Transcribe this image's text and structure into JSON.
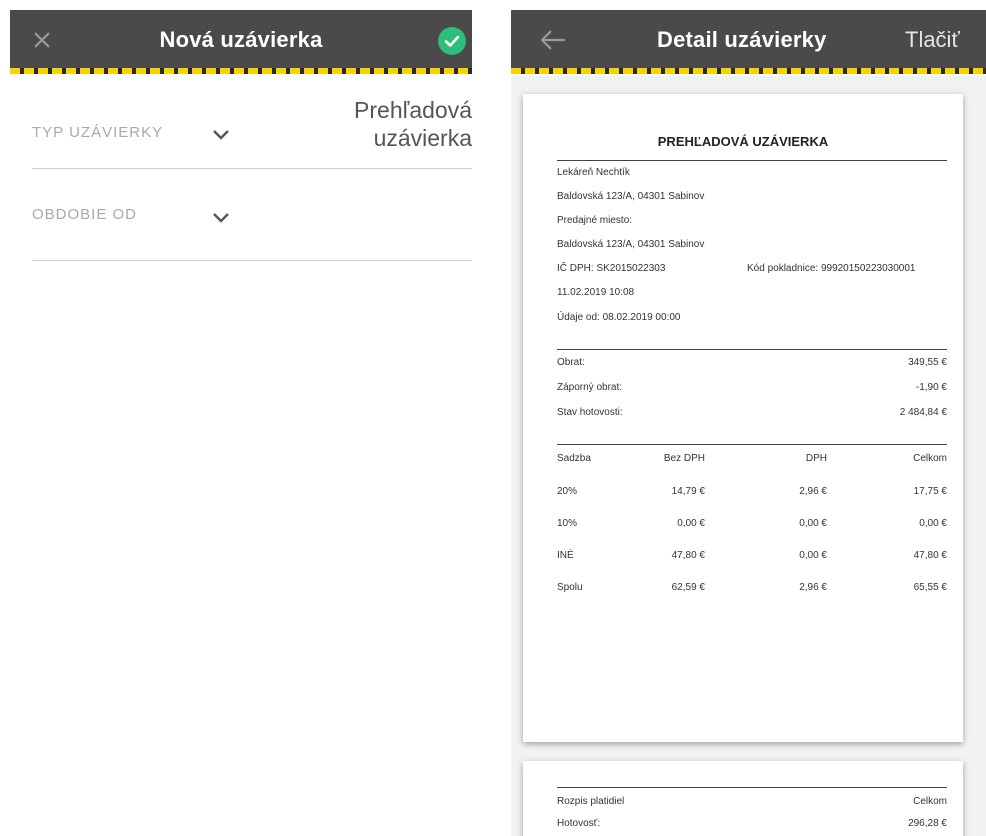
{
  "left_screen": {
    "title": "Nová uzávierka",
    "fields": [
      {
        "label": "TYP UZÁVIERKY",
        "value": "Prehľadová uzávierka"
      },
      {
        "label": "OBDOBIE OD",
        "value": ""
      }
    ]
  },
  "right_screen": {
    "title": "Detail uzávierky",
    "print_label": "Tlačiť",
    "receipt": {
      "title": "PREHĽADOVÁ UZÁVIERKA",
      "header_lines": [
        "Lekáreň Nechtík",
        "Baldovská 123/A, 04301 Sabinov",
        "Predajné miesto:",
        "Baldovská 123/A, 04301 Sabinov",
        "IČ DPH: SK2015022303",
        "11.02.2019 10:08",
        "Údaje od: 08.02.2019 00:00"
      ],
      "register_code": "Kód pokladnice: 99920150223030001",
      "summary": [
        {
          "label": "Obrat:",
          "value": "349,55 €"
        },
        {
          "label": "Záporný obrat:",
          "value": "-1,90 €"
        },
        {
          "label": "Stav hotovosti:",
          "value": "2 484,84 €"
        }
      ],
      "table": {
        "headers": [
          "Sadzba",
          "Bez DPH",
          "DPH",
          "Celkom"
        ],
        "rows": [
          [
            "20%",
            "14,79 €",
            "2,96 €",
            "17,75 €"
          ],
          [
            "10%",
            "0,00 €",
            "0,00 €",
            "0,00 €"
          ],
          [
            "INÉ",
            "47,80 €",
            "0,00 €",
            "47,80 €"
          ],
          [
            "Spolu",
            "62,59 €",
            "2,96 €",
            "65,55 €"
          ]
        ]
      },
      "payments": {
        "header_label": "Rozpis platidiel",
        "header_value": "Celkom",
        "rows": [
          {
            "label": "Hotovosť:",
            "value": "296,28 €"
          }
        ]
      }
    }
  }
}
